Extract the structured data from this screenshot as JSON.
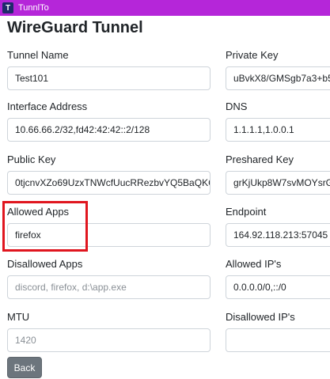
{
  "window": {
    "icon_letter": "T",
    "title": "TunnlTo"
  },
  "page": {
    "title": "WireGuard Tunnel"
  },
  "fields": {
    "tunnel_name": {
      "label": "Tunnel Name",
      "value": "Test101"
    },
    "private_key": {
      "label": "Private Key",
      "value": "uBvkX8/GMSgb7a3+b5"
    },
    "interface_address": {
      "label": "Interface Address",
      "value": "10.66.66.2/32,fd42:42:42::2/128"
    },
    "dns": {
      "label": "DNS",
      "value": "1.1.1.1,1.0.0.1"
    },
    "public_key": {
      "label": "Public Key",
      "value": "0tjcnvXZo69UzxTNWcfUucRRezbvYQ5BaQKC"
    },
    "preshared_key": {
      "label": "Preshared Key",
      "value": "grKjUkp8W7svMOYsrG"
    },
    "allowed_apps": {
      "label": "Allowed Apps",
      "value": "firefox"
    },
    "endpoint": {
      "label": "Endpoint",
      "value": "164.92.118.213:57045"
    },
    "disallowed_apps": {
      "label": "Disallowed Apps",
      "placeholder": "discord, firefox, d:\\app.exe"
    },
    "allowed_ips": {
      "label": "Allowed IP's",
      "value": "0.0.0.0/0,::/0"
    },
    "mtu": {
      "label": "MTU",
      "placeholder": "1420"
    },
    "disallowed_ips": {
      "label": "Disallowed IP's",
      "value": ""
    }
  },
  "actions": {
    "back_label": "Back"
  },
  "colors": {
    "titlebar": "#b526d9",
    "highlight": "#e0161f",
    "button": "#6c757d"
  }
}
